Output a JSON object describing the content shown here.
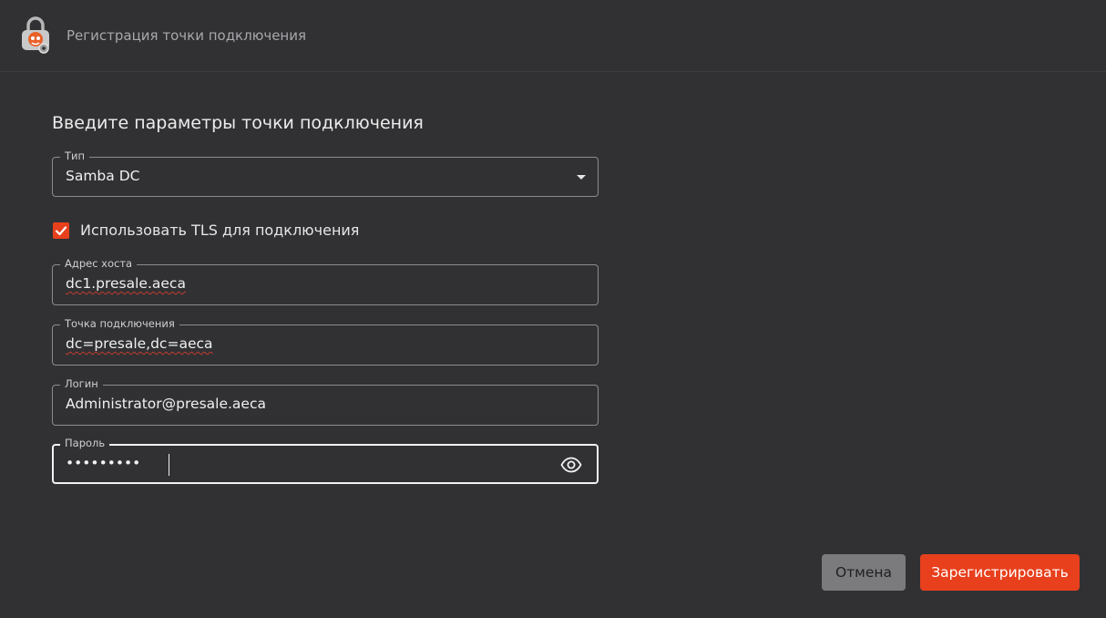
{
  "window": {
    "title": "Регистрация точки подключения",
    "app_icon": "lock-app-icon"
  },
  "form": {
    "heading": "Введите параметры точки подключения",
    "type": {
      "label": "Тип",
      "value": "Samba DC"
    },
    "tls": {
      "label": "Использовать TLS для подключения",
      "checked": true
    },
    "host": {
      "label": "Адрес хоста",
      "value": "dc1.presale.aeca"
    },
    "base_dn": {
      "label": "Точка подключения",
      "value": "dc=presale,dc=aeca"
    },
    "login": {
      "label": "Логин",
      "value": "Administrator@presale.aeca"
    },
    "password": {
      "label": "Пароль",
      "value": "•••••••••",
      "toggle_icon": "eye-icon"
    }
  },
  "buttons": {
    "cancel": "Отмена",
    "register": "Зарегистрировать"
  },
  "colors": {
    "accent": "#e8401c",
    "background": "#313134",
    "cancel_button": "#7b7b7e"
  }
}
